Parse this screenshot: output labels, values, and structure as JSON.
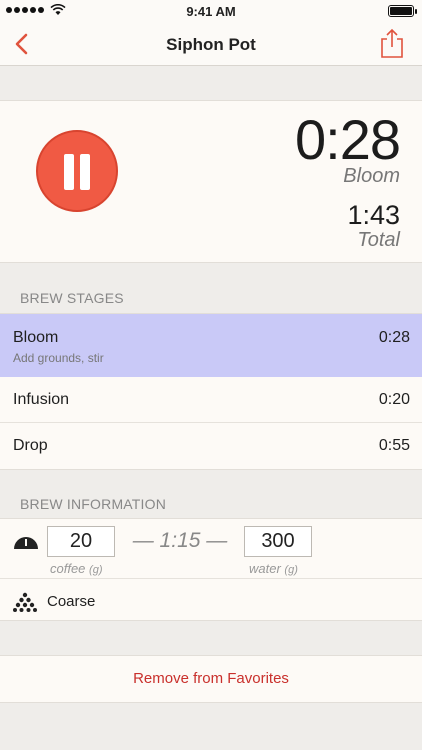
{
  "status_bar": {
    "time": "9:41 AM",
    "signal_icon": "signal-dots-icon",
    "wifi_icon": "wifi-icon",
    "battery_icon": "battery-icon"
  },
  "nav": {
    "title": "Siphon Pot",
    "back_icon": "chevron-left-icon",
    "share_icon": "share-icon",
    "accent_color": "#e0533d"
  },
  "timer": {
    "state_icon": "pause-icon",
    "stage_time": "0:28",
    "stage_name": "Bloom",
    "total_time": "1:43",
    "total_label": "Total"
  },
  "brew_stages": {
    "header": "BREW STAGES",
    "items": [
      {
        "name": "Bloom",
        "subtitle": "Add grounds, stir",
        "duration": "0:28",
        "active": true
      },
      {
        "name": "Infusion",
        "duration": "0:20",
        "active": false
      },
      {
        "name": "Drop",
        "duration": "0:55",
        "active": false
      }
    ],
    "active_color": "#c9c9f7"
  },
  "brew_info": {
    "header": "BREW INFORMATION",
    "coffee_amount": "20",
    "coffee_label": "coffee",
    "coffee_unit": "(g)",
    "ratio": "— 1:15 —",
    "water_amount": "300",
    "water_label": "water",
    "water_unit": "(g)",
    "scale_icon": "scale-icon",
    "grind_icon": "grind-dots-icon",
    "grind": "Coarse"
  },
  "actions": {
    "remove_favorites": "Remove from Favorites",
    "remove_color": "#c9302c"
  }
}
